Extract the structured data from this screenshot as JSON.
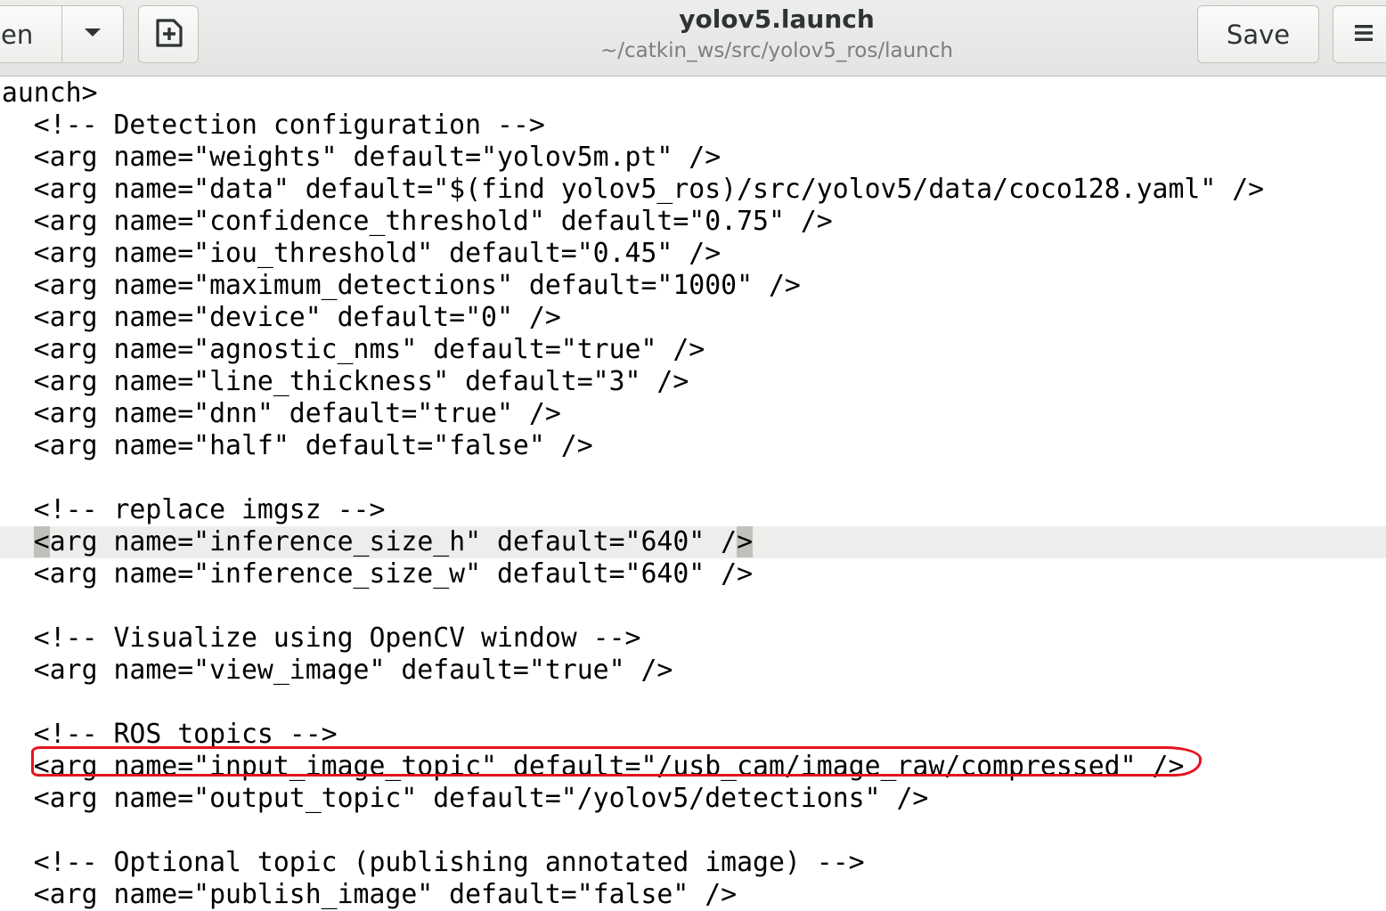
{
  "header": {
    "open_label": "en",
    "title": "yolov5.launch",
    "subtitle": "~/catkin_ws/src/yolov5_ros/launch",
    "save_label": "Save",
    "icons": [
      "chevron-down-icon",
      "new-document-icon",
      "hamburger-menu-icon"
    ]
  },
  "editor": {
    "current_line": 14,
    "bracket_match": {
      "open": "<",
      "close": ">"
    },
    "annotation_color": "#e5131f",
    "annotated_line": 21,
    "lines": [
      "<launch>",
      "    <!-- Detection configuration -->",
      "    <arg name=\"weights\" default=\"yolov5m.pt\" />",
      "    <arg name=\"data\" default=\"$(find yolov5_ros)/src/yolov5/data/coco128.yaml\" />",
      "    <arg name=\"confidence_threshold\" default=\"0.75\" />",
      "    <arg name=\"iou_threshold\" default=\"0.45\" />",
      "    <arg name=\"maximum_detections\" default=\"1000\" />",
      "    <arg name=\"device\" default=\"0\" />",
      "    <arg name=\"agnostic_nms\" default=\"true\" />",
      "    <arg name=\"line_thickness\" default=\"3\" />",
      "    <arg name=\"dnn\" default=\"true\" />",
      "    <arg name=\"half\" default=\"false\" />",
      "",
      "    <!-- replace imgsz -->",
      "    <arg name=\"inference_size_h\" default=\"640\" />",
      "    <arg name=\"inference_size_w\" default=\"640\" />",
      "",
      "    <!-- Visualize using OpenCV window -->",
      "    <arg name=\"view_image\" default=\"true\" />",
      "",
      "    <!-- ROS topics -->",
      "    <arg name=\"input_image_topic\" default=\"/usb_cam/image_raw/compressed\" />",
      "    <arg name=\"output_topic\" default=\"/yolov5/detections\" />",
      "",
      "    <!-- Optional topic (publishing annotated image) -->",
      "    <arg name=\"publish_image\" default=\"false\" />"
    ]
  }
}
